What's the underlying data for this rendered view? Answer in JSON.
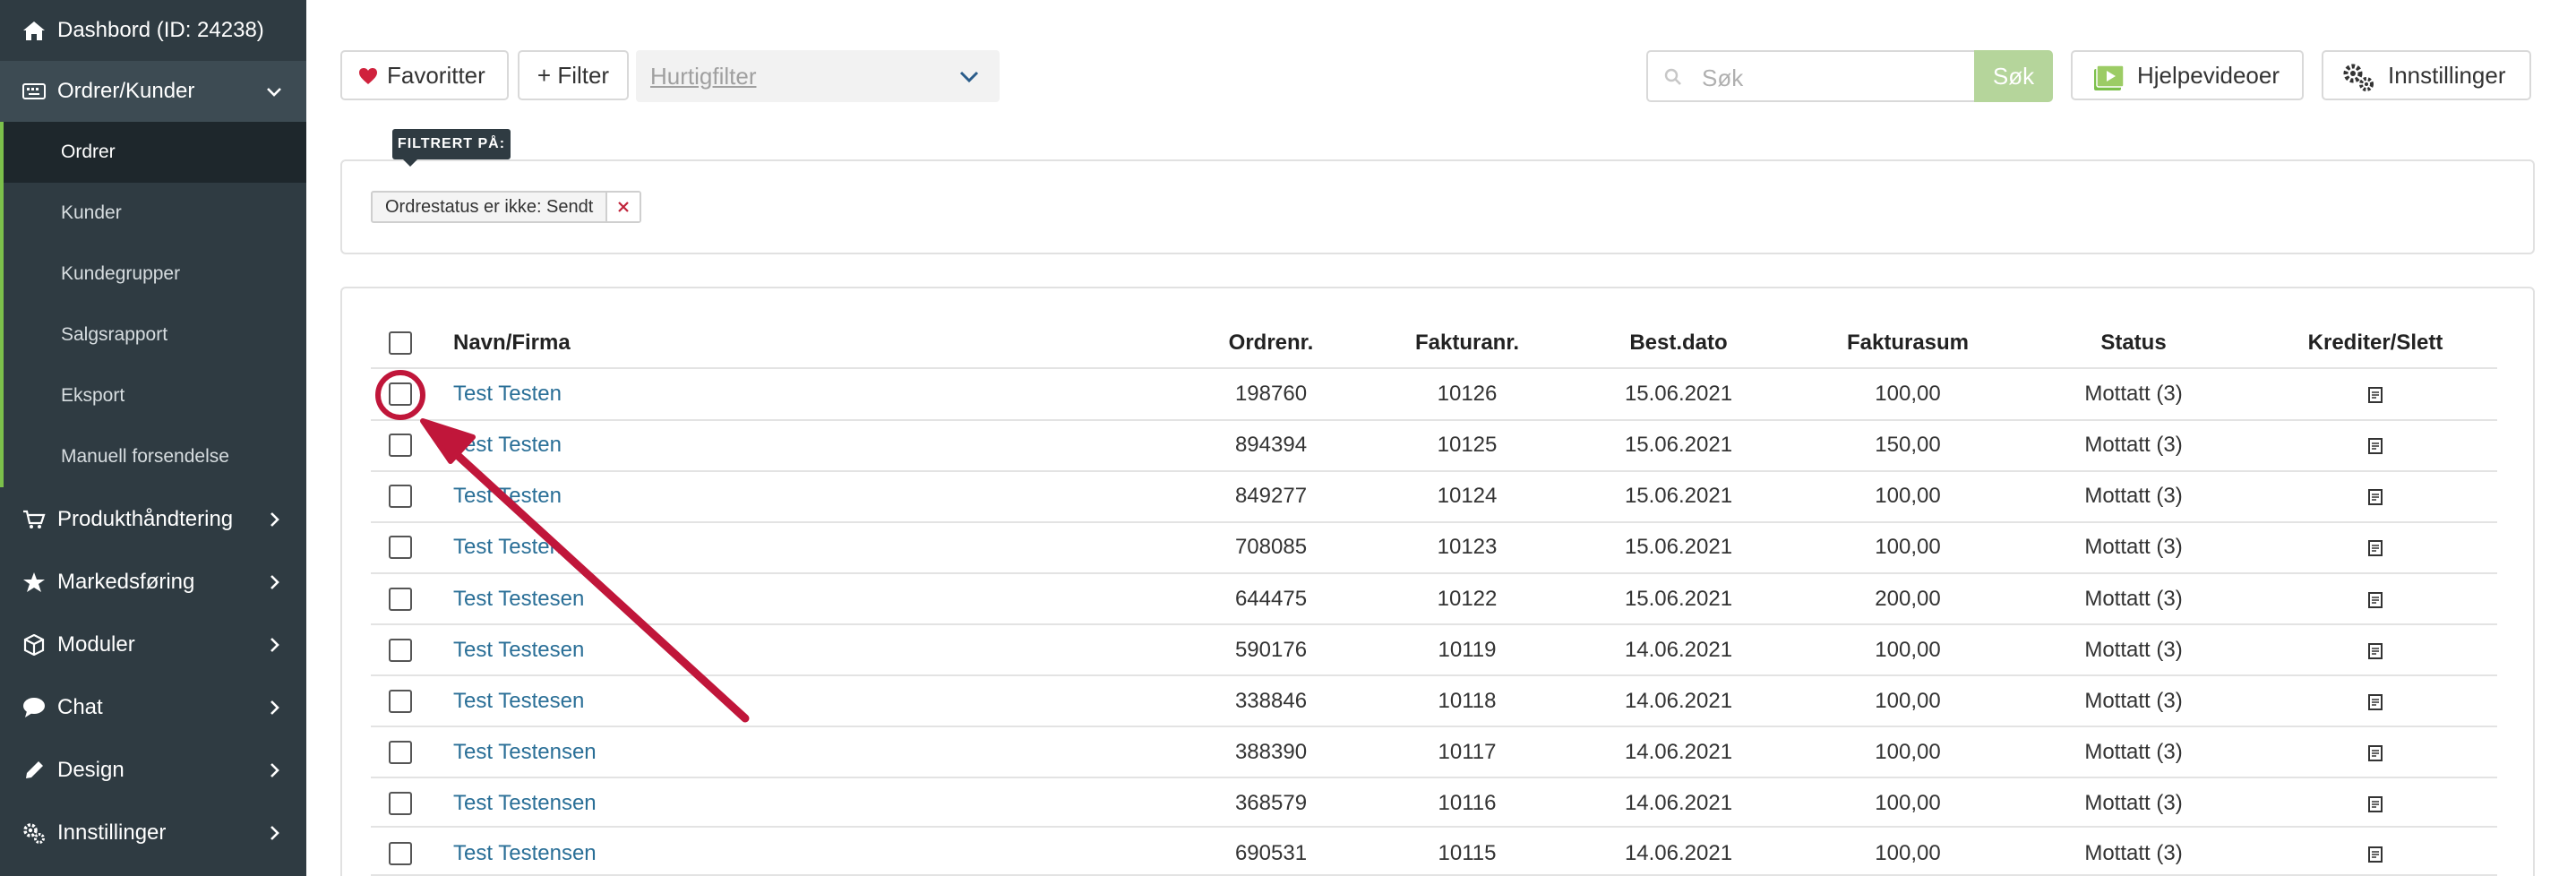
{
  "sidebar": {
    "items": [
      {
        "label": "Dashbord (ID: 24238)",
        "icon": "home-icon"
      },
      {
        "label": "Ordrer/Kunder",
        "icon": "keyboard-icon"
      },
      {
        "label": "Produkthåndtering",
        "icon": "cart-icon"
      },
      {
        "label": "Markedsføring",
        "icon": "star-icon"
      },
      {
        "label": "Moduler",
        "icon": "cube-icon"
      },
      {
        "label": "Chat",
        "icon": "chat-icon"
      },
      {
        "label": "Design",
        "icon": "pencil-icon"
      },
      {
        "label": "Innstillinger",
        "icon": "gears-icon"
      }
    ],
    "subitems": [
      "Ordrer",
      "Kunder",
      "Kundegrupper",
      "Salgsrapport",
      "Eksport",
      "Manuell forsendelse"
    ],
    "accent": "#7cc04b"
  },
  "toolbar": {
    "favorites": "Favoritter",
    "filter": "+ Filter",
    "quickfilter": "Hurtigfilter",
    "search_placeholder": "Søk",
    "search_button": "Søk",
    "help_videos": "Hjelpevideoer",
    "settings": "Innstillinger"
  },
  "filter": {
    "tag": "FILTRERT PÅ:",
    "chip": "Ordrestatus er ikke: Sendt"
  },
  "table": {
    "headers": {
      "name": "Navn/Firma",
      "order_no": "Ordrenr.",
      "invoice_no": "Fakturanr.",
      "order_date": "Best.dato",
      "invoice_sum": "Fakturasum",
      "status": "Status",
      "credit_delete": "Krediter/Slett"
    },
    "rows": [
      {
        "name": "Test Testen",
        "order_no": "198760",
        "invoice_no": "10126",
        "order_date": "15.06.2021",
        "invoice_sum": "100,00",
        "status": "Mottatt (3)"
      },
      {
        "name": "Test Testen",
        "order_no": "894394",
        "invoice_no": "10125",
        "order_date": "15.06.2021",
        "invoice_sum": "150,00",
        "status": "Mottatt (3)"
      },
      {
        "name": "Test Testen",
        "order_no": "849277",
        "invoice_no": "10124",
        "order_date": "15.06.2021",
        "invoice_sum": "100,00",
        "status": "Mottatt (3)"
      },
      {
        "name": "Test Testen",
        "order_no": "708085",
        "invoice_no": "10123",
        "order_date": "15.06.2021",
        "invoice_sum": "100,00",
        "status": "Mottatt (3)"
      },
      {
        "name": "Test Testesen",
        "order_no": "644475",
        "invoice_no": "10122",
        "order_date": "15.06.2021",
        "invoice_sum": "200,00",
        "status": "Mottatt (3)"
      },
      {
        "name": "Test Testesen",
        "order_no": "590176",
        "invoice_no": "10119",
        "order_date": "14.06.2021",
        "invoice_sum": "100,00",
        "status": "Mottatt (3)"
      },
      {
        "name": "Test Testesen",
        "order_no": "338846",
        "invoice_no": "10118",
        "order_date": "14.06.2021",
        "invoice_sum": "100,00",
        "status": "Mottatt (3)"
      },
      {
        "name": "Test Testensen",
        "order_no": "388390",
        "invoice_no": "10117",
        "order_date": "14.06.2021",
        "invoice_sum": "100,00",
        "status": "Mottatt (3)"
      },
      {
        "name": "Test Testensen",
        "order_no": "368579",
        "invoice_no": "10116",
        "order_date": "14.06.2021",
        "invoice_sum": "100,00",
        "status": "Mottatt (3)"
      },
      {
        "name": "Test Testensen",
        "order_no": "690531",
        "invoice_no": "10115",
        "order_date": "14.06.2021",
        "invoice_sum": "100,00",
        "status": "Mottatt (3)"
      }
    ]
  },
  "annotation": {
    "color": "#c0163a"
  },
  "colors": {
    "sidebar_bg": "#2f3b42",
    "link": "#2a6f97",
    "search_button": "#b5d59b",
    "heart": "#d0223d"
  }
}
